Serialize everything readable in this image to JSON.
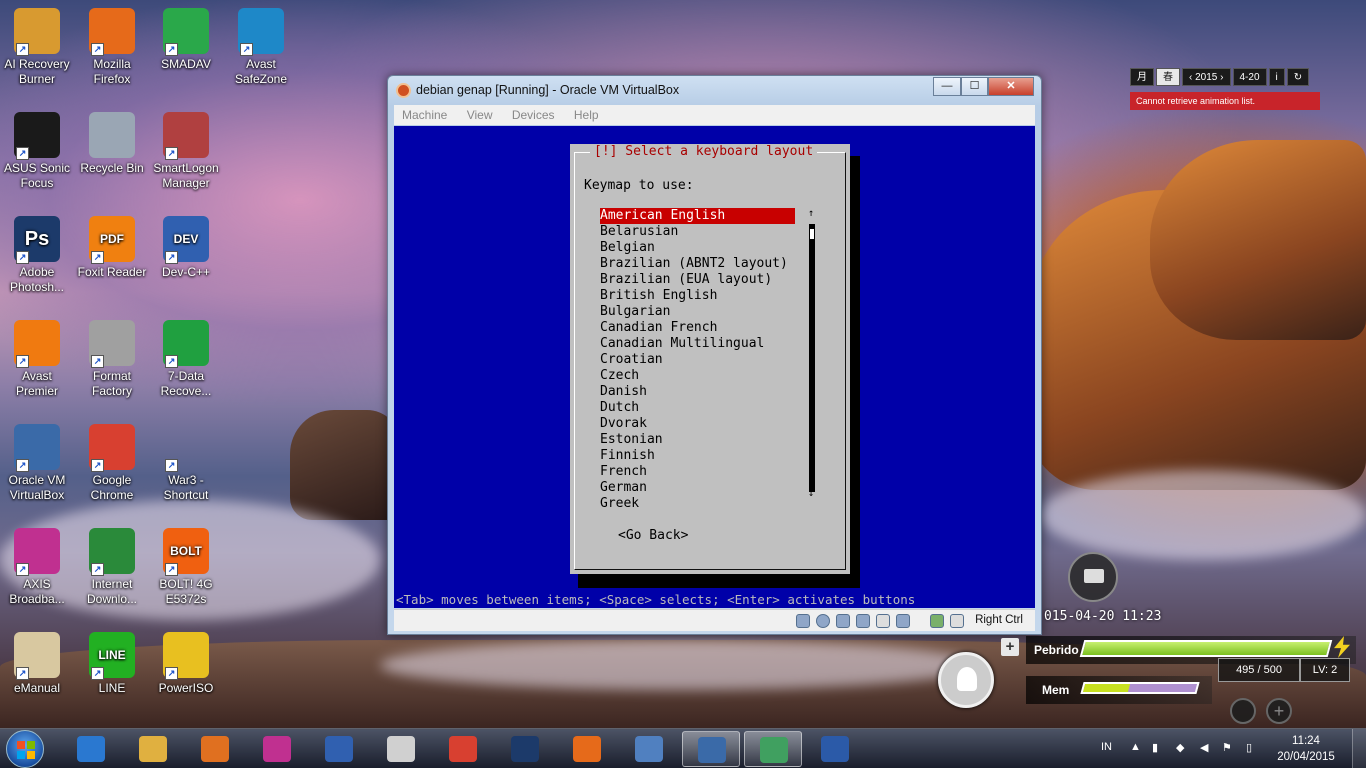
{
  "desktop": {
    "icons": [
      {
        "label": "AI Recovery Burner",
        "icon": "ai-recovery-burner-icon",
        "color": "#d89a30"
      },
      {
        "label": "Mozilla Firefox",
        "icon": "firefox-icon",
        "color": "#e66a1a"
      },
      {
        "label": "SMADAV",
        "icon": "smadav-icon",
        "color": "#2aa84a"
      },
      {
        "label": "Avast SafeZone",
        "icon": "avast-safezone-icon",
        "color": "#1e88c8"
      },
      {
        "label": "ASUS Sonic Focus",
        "icon": "asus-sonic-focus-icon",
        "color": "#1a1a1a"
      },
      {
        "label": "Recycle Bin",
        "icon": "recycle-bin-icon",
        "color": "#9aa6b4"
      },
      {
        "label": "SmartLogon Manager",
        "icon": "smartlogon-icon",
        "color": "#b04040"
      },
      {
        "label": "Adobe Photosh...",
        "icon": "photoshop-icon",
        "color": "#1c3a6a",
        "glyph": "Ps"
      },
      {
        "label": "Foxit Reader",
        "icon": "foxit-reader-icon",
        "color": "#f08010",
        "glyph": "PDF"
      },
      {
        "label": "Dev-C++",
        "icon": "dev-cpp-icon",
        "color": "#3060b0",
        "glyph": "DEV"
      },
      {
        "label": "Avast Premier",
        "icon": "avast-premier-icon",
        "color": "#f07a10"
      },
      {
        "label": "Format Factory",
        "icon": "format-factory-icon",
        "color": "#a0a0a0"
      },
      {
        "label": "7-Data Recove...",
        "icon": "7-data-recovery-icon",
        "color": "#20a040"
      },
      {
        "label": "Oracle VM VirtualBox",
        "icon": "virtualbox-icon",
        "color": "#3a6aa8"
      },
      {
        "label": "Google Chrome",
        "icon": "chrome-icon",
        "color": "#d84030"
      },
      {
        "label": "War3 - Shortcut",
        "icon": "war3-shortcut-icon",
        "color": "transparent"
      },
      {
        "label": "AXIS Broadba...",
        "icon": "axis-broadband-icon",
        "color": "#c03090"
      },
      {
        "label": "Internet Downlo...",
        "icon": "idm-icon",
        "color": "#2a8a3a"
      },
      {
        "label": "BOLT! 4G E5372s",
        "icon": "bolt-4g-icon",
        "color": "#f06010",
        "glyph": "BOLT"
      },
      {
        "label": "eManual",
        "icon": "emanual-icon",
        "color": "#d8c8a0"
      },
      {
        "label": "LINE",
        "icon": "line-icon",
        "color": "#22b022",
        "glyph": "LINE"
      },
      {
        "label": "PowerISO",
        "icon": "poweriso-icon",
        "color": "#e8c020"
      }
    ]
  },
  "vbox": {
    "title": "debian genap [Running] - Oracle VM VirtualBox",
    "minimize": "—",
    "maximize": "☐",
    "close": "✕",
    "menu": [
      "Machine",
      "View",
      "Devices",
      "Help"
    ],
    "host_key": "Right Ctrl"
  },
  "installer": {
    "title": "[!] Select a keyboard layout",
    "prompt": "Keymap to use:",
    "selected_index": 0,
    "keymaps": [
      "American English",
      "Belarusian",
      "Belgian",
      "Brazilian (ABNT2 layout)",
      "Brazilian (EUA layout)",
      "British English",
      "Bulgarian",
      "Canadian French",
      "Canadian Multilingual",
      "Croatian",
      "Czech",
      "Danish",
      "Dutch",
      "Dvorak",
      "Estonian",
      "Finnish",
      "French",
      "German",
      "Greek"
    ],
    "go_back": "<Go Back>",
    "help_line": "<Tab> moves between items; <Space> selects; <Enter> activates buttons"
  },
  "widgets": {
    "calendar": {
      "month_label": "月",
      "season_label": "春",
      "prev": "‹",
      "year": "2015",
      "next": "›",
      "date": "4-20",
      "info": "i",
      "refresh": "↻"
    },
    "calendar_error": "Cannot retrieve animation list.",
    "datetime": "015-04-20  11:23",
    "battery": {
      "label": "Pebrido",
      "value": "495 / 500",
      "level": "LV: 2",
      "fraction": 0.99
    },
    "memory": {
      "label": "Mem",
      "fraction": 0.4
    },
    "plus": "+"
  },
  "taskbar": {
    "apps": [
      {
        "name": "internet-explorer",
        "color": "#2a78d0"
      },
      {
        "name": "windows-explorer",
        "color": "#e0b040"
      },
      {
        "name": "media-player",
        "color": "#e07020"
      },
      {
        "name": "axis-app",
        "color": "#c03090"
      },
      {
        "name": "dev-cpp",
        "color": "#3060b0"
      },
      {
        "name": "media-player-321",
        "color": "#d0d0d0"
      },
      {
        "name": "chrome",
        "color": "#d84030"
      },
      {
        "name": "photoshop",
        "color": "#1c3a6a"
      },
      {
        "name": "firefox",
        "color": "#e66a1a"
      },
      {
        "name": "remote-desktop",
        "color": "#5080c0"
      },
      {
        "name": "virtualbox",
        "color": "#3a6aa8"
      },
      {
        "name": "virtualbox-vm",
        "color": "#40a060"
      },
      {
        "name": "word",
        "color": "#2b5aa8"
      }
    ],
    "language": "IN",
    "time": "11:24",
    "date": "20/04/2015"
  }
}
